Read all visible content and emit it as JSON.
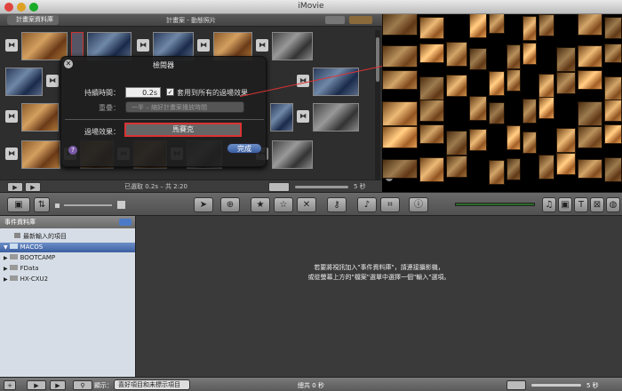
{
  "window": {
    "title": "iMovie"
  },
  "project": {
    "library_button": "計畫案資料庫",
    "title": "計畫案 - 動態照片",
    "status": "已選取 0.2s – 共 2:20",
    "zoom": "5 秒"
  },
  "inspector": {
    "title": "檢閱器",
    "duration_label": "持續時間：",
    "duration_value": "0.2s",
    "apply_all_label": "套用到所有的過場效果",
    "overlap_label": "重疊：",
    "overlap_value": "一半 – 縮好計畫案播放時間",
    "transition_label": "過場效果：",
    "transition_value": "馬賽克",
    "done_label": "完成"
  },
  "library": {
    "header": "事件資料庫",
    "items": [
      "最新輸入的項目",
      "MACOS",
      "BOOTCAMP",
      "FData",
      "HX-CXU2"
    ]
  },
  "events": {
    "message_line1": "若要將視訊加入\"事件資料庫\"，請連接攝影機，",
    "message_line2": "或從螢幕上方的\"檔案\"選單中選擇一個\"輸入\"選項。"
  },
  "bottombar": {
    "show_label": "顯示：",
    "filter_value": "喜好項目和未標示項目",
    "total": "總共 0 秒",
    "zoom": "5 秒"
  }
}
